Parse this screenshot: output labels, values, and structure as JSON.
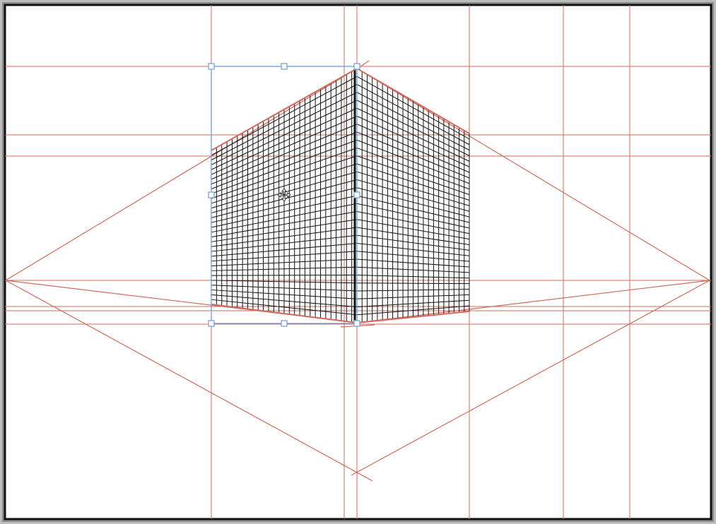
{
  "document": {
    "canvas": {
      "background": "#ffffff",
      "border": "#111111"
    },
    "colors": {
      "guide": "#d16a5c",
      "grid": "#111111",
      "selection": "#6f9cd6",
      "handle_fill": "#ffffff",
      "cursor": "#333333"
    },
    "cursor_icon": "move-cursor-icon",
    "perspective_grid": {
      "left_plane_columns": 28,
      "right_plane_columns": 22,
      "rows": 32,
      "vanishing_points": 3
    }
  }
}
